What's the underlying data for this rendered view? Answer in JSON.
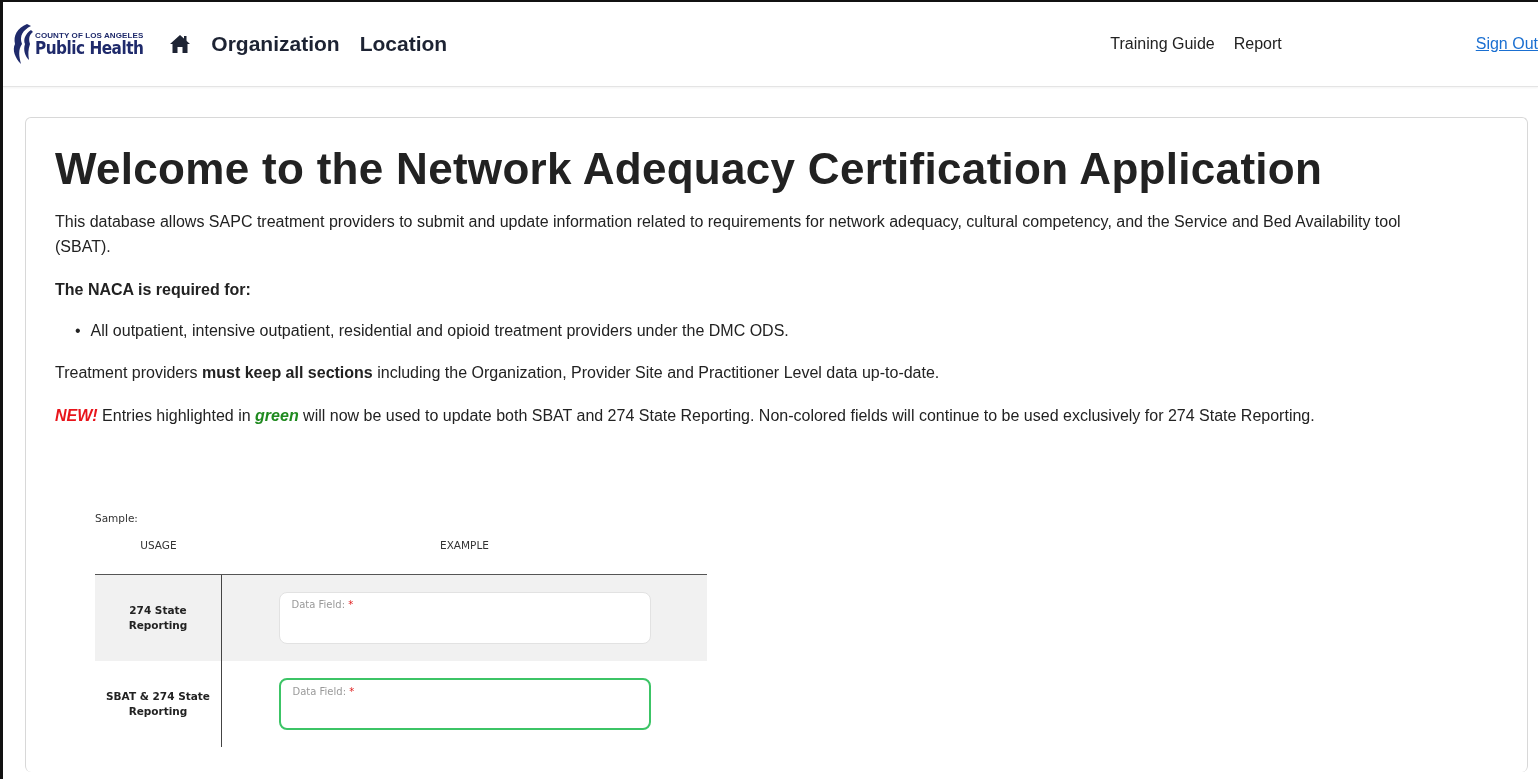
{
  "header": {
    "logo": {
      "small": "COUNTY OF LOS ANGELES",
      "big": "Public Health"
    },
    "nav": [
      {
        "label": "Organization"
      },
      {
        "label": "Location"
      }
    ],
    "links": [
      {
        "label": "Training Guide"
      },
      {
        "label": "Report"
      }
    ],
    "sign_out": "Sign Out"
  },
  "main": {
    "title": "Welcome to the Network Adequacy Certification Application",
    "intro": "This database allows SAPC treatment providers to submit and update information related to requirements for network adequacy, cultural competency, and the Service and Bed Availability tool (SBAT).",
    "required_heading": "The NACA is required for:",
    "bullets": [
      {
        "marker": "•",
        "text": "All outpatient, intensive outpatient, residential and opioid treatment providers under the DMC ODS."
      }
    ],
    "sections_note": "Treatment providers **must keep all sections** including the Organization, Provider Site and Practitioner Level data up-to-date.",
    "notice": {
      "badge": "NEW!",
      "before": "Entries highlighted in",
      "highlight": "green",
      "after": "will now be used to update both SBAT and 274 State Reporting. Non-colored fields will continue to be used exclusively for 274 State Reporting."
    },
    "sample": {
      "caption": "Sample:",
      "columns": [
        "USAGE",
        "EXAMPLE"
      ],
      "rows": [
        {
          "usage": "274 State Reporting",
          "field_label": "Data Field:",
          "required_mark": "*",
          "highlighted": false
        },
        {
          "usage": "SBAT & 274 State Reporting",
          "field_label": "Data Field:",
          "required_mark": "*",
          "highlighted": true
        }
      ]
    }
  }
}
